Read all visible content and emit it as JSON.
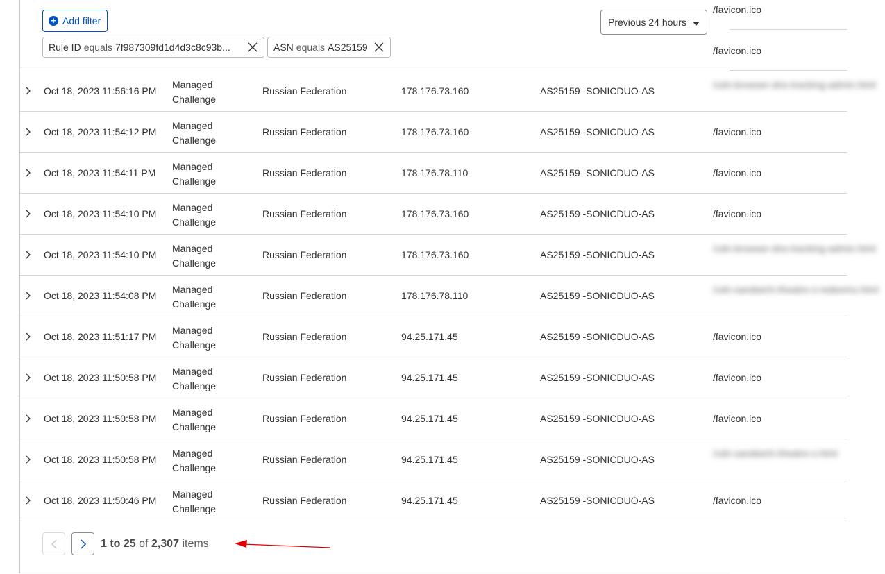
{
  "toolbar": {
    "add_filter_label": "Add filter",
    "filters": [
      {
        "field": "Rule ID",
        "operator": "equals",
        "value": "7f987309fd1d4d3c8c93b..."
      },
      {
        "field": "ASN",
        "operator": "equals",
        "value": "AS25159"
      }
    ],
    "time_range": "Previous 24 hours"
  },
  "top_paths": [
    "/favicon.ico",
    "/favicon.ico"
  ],
  "rows": [
    {
      "date": "Oct 18, 2023 11:56:16 PM",
      "action_line1": "Managed",
      "action_line2": "Challenge",
      "country": "Russian Federation",
      "ip": "178.176.73.160",
      "asn": "AS25159 -SONICDUO-AS",
      "path": "/cdn-browser-dns-tracking-admin.html",
      "path_blurred": true
    },
    {
      "date": "Oct 18, 2023 11:54:12 PM",
      "action_line1": "Managed",
      "action_line2": "Challenge",
      "country": "Russian Federation",
      "ip": "178.176.73.160",
      "asn": "AS25159 -SONICDUO-AS",
      "path": "/favicon.ico",
      "path_blurred": false
    },
    {
      "date": "Oct 18, 2023 11:54:11 PM",
      "action_line1": "Managed",
      "action_line2": "Challenge",
      "country": "Russian Federation",
      "ip": "178.176.78.110",
      "asn": "AS25159 -SONICDUO-AS",
      "path": "/favicon.ico",
      "path_blurred": false
    },
    {
      "date": "Oct 18, 2023 11:54:10 PM",
      "action_line1": "Managed",
      "action_line2": "Challenge",
      "country": "Russian Federation",
      "ip": "178.176.73.160",
      "asn": "AS25159 -SONICDUO-AS",
      "path": "/favicon.ico",
      "path_blurred": false
    },
    {
      "date": "Oct 18, 2023 11:54:10 PM",
      "action_line1": "Managed",
      "action_line2": "Challenge",
      "country": "Russian Federation",
      "ip": "178.176.73.160",
      "asn": "AS25159 -SONICDUO-AS",
      "path": "/cdn-browser-dns-tracking-admin.html",
      "path_blurred": true
    },
    {
      "date": "Oct 18, 2023 11:54:08 PM",
      "action_line1": "Managed",
      "action_line2": "Challenge",
      "country": "Russian Federation",
      "ip": "178.176.78.110",
      "asn": "AS25159 -SONICDUO-AS",
      "path": "/cdn-sandwich-theatre-s-redeems.html",
      "path_blurred": true
    },
    {
      "date": "Oct 18, 2023 11:51:17 PM",
      "action_line1": "Managed",
      "action_line2": "Challenge",
      "country": "Russian Federation",
      "ip": "94.25.171.45",
      "asn": "AS25159 -SONICDUO-AS",
      "path": "/favicon.ico",
      "path_blurred": false
    },
    {
      "date": "Oct 18, 2023 11:50:58 PM",
      "action_line1": "Managed",
      "action_line2": "Challenge",
      "country": "Russian Federation",
      "ip": "94.25.171.45",
      "asn": "AS25159 -SONICDUO-AS",
      "path": "/favicon.ico",
      "path_blurred": false
    },
    {
      "date": "Oct 18, 2023 11:50:58 PM",
      "action_line1": "Managed",
      "action_line2": "Challenge",
      "country": "Russian Federation",
      "ip": "94.25.171.45",
      "asn": "AS25159 -SONICDUO-AS",
      "path": "/favicon.ico",
      "path_blurred": false
    },
    {
      "date": "Oct 18, 2023 11:50:58 PM",
      "action_line1": "Managed",
      "action_line2": "Challenge",
      "country": "Russian Federation",
      "ip": "94.25.171.45",
      "asn": "AS25159 -SONICDUO-AS",
      "path": "/cdn-sandwich-theatre-s.html",
      "path_blurred": true
    },
    {
      "date": "Oct 18, 2023 11:50:46 PM",
      "action_line1": "Managed",
      "action_line2": "Challenge",
      "country": "Russian Federation",
      "ip": "94.25.171.45",
      "asn": "AS25159 -SONICDUO-AS",
      "path": "/favicon.ico",
      "path_blurred": false
    }
  ],
  "pagination": {
    "range": "1 to 25",
    "of_label": "of",
    "total": "2,307",
    "unit": "items"
  },
  "colors": {
    "accent": "#0051c3",
    "annotation_arrow": "#e00000"
  }
}
